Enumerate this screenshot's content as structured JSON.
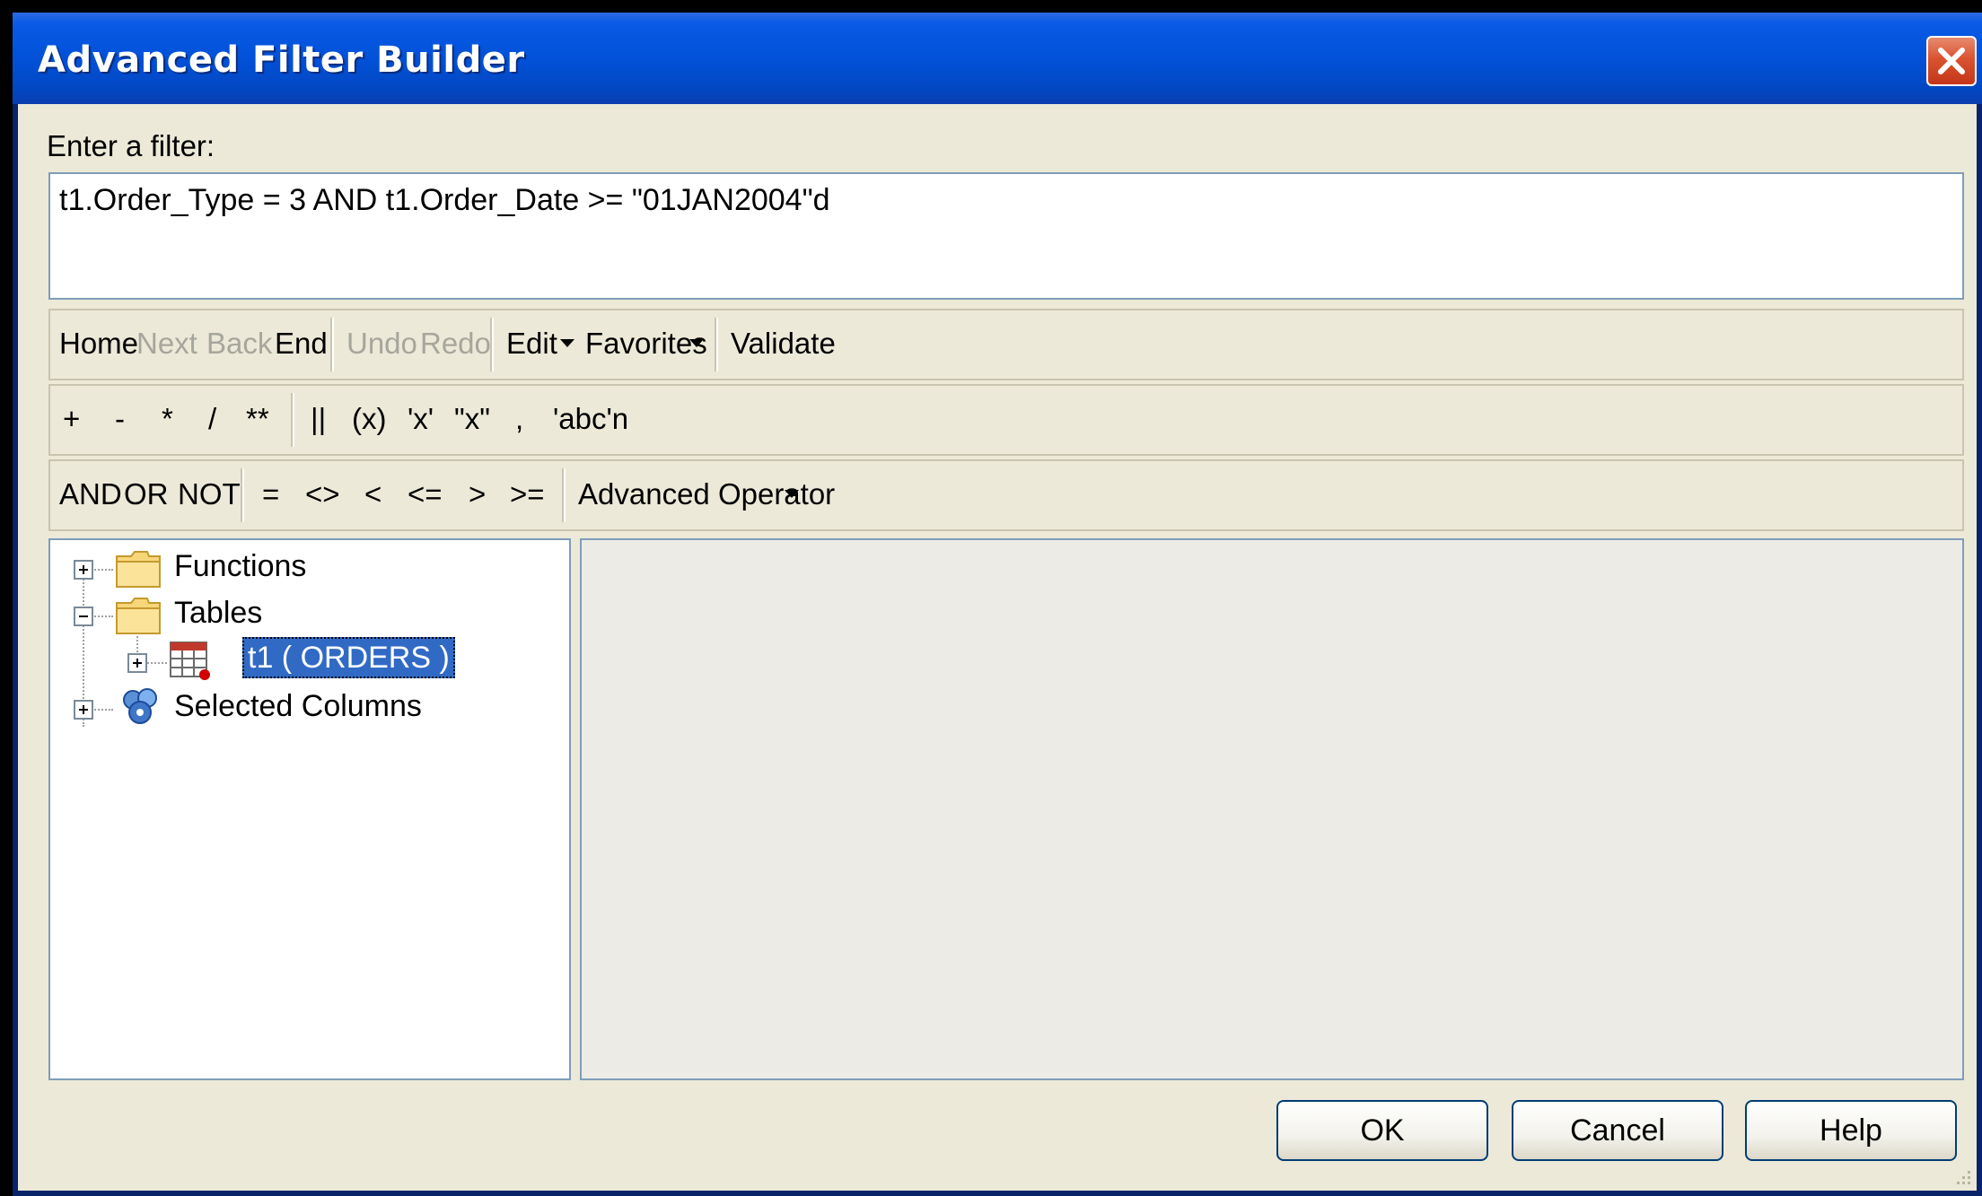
{
  "window": {
    "title": "Advanced Filter Builder"
  },
  "filter": {
    "label": "Enter a filter:",
    "value": "t1.Order_Type = 3 AND t1.Order_Date >= \"01JAN2004\"d"
  },
  "toolbar1": {
    "home": "Home",
    "next": "Next",
    "back": "Back",
    "end": "End",
    "undo": "Undo",
    "redo": "Redo",
    "edit": "Edit",
    "favorites": "Favorites",
    "validate": "Validate"
  },
  "toolbar2": {
    "plus": "+",
    "minus": "-",
    "multiply": "*",
    "divide": "/",
    "power": "**",
    "concat": "||",
    "parens": "(x)",
    "single_quote": "'x'",
    "double_quote": "\"x\"",
    "comma": ",",
    "newline_string": "'abc'n"
  },
  "toolbar3": {
    "and": "AND",
    "or": "OR",
    "not": "NOT",
    "eq": "=",
    "ne": "<>",
    "lt": "<",
    "le": "<=",
    "gt": ">",
    "ge": ">=",
    "advanced_operator": "Advanced Operator"
  },
  "tree": {
    "functions": "Functions",
    "tables": "Tables",
    "table_t1": "t1 ( ORDERS )",
    "selected_columns": "Selected Columns"
  },
  "buttons": {
    "ok": "OK",
    "cancel": "Cancel",
    "help": "Help"
  },
  "colors": {
    "titlebar": "#0251d8",
    "selection": "#316ac5",
    "face": "#ece9d8",
    "border": "#7f9db9"
  },
  "icons": [
    "close-icon",
    "folder-icon",
    "table-icon",
    "columns-icon",
    "expand-icon",
    "collapse-icon",
    "dropdown-caret-icon",
    "resize-grip-icon"
  ]
}
